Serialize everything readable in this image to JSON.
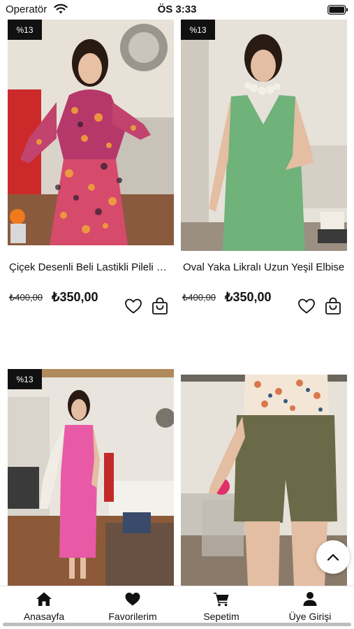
{
  "status_bar": {
    "carrier": "Operatör",
    "time": "ÖS 3:33"
  },
  "products": [
    {
      "badge": "%13",
      "title": "Çiçek Desenli Beli Lastikli Pileli Elbise",
      "old_price": "₺400,00",
      "price": "₺350,00"
    },
    {
      "badge": "%13",
      "title": "Oval Yaka Likralı Uzun Yeşil Elbise",
      "old_price": "₺400,00",
      "price": "₺350,00"
    },
    {
      "badge": "%13"
    },
    {
      "badge": ""
    }
  ],
  "tab_bar": {
    "home": "Anasayfa",
    "favorites": "Favorilerim",
    "cart": "Sepetim",
    "account": "Üye Girişi"
  },
  "icons": {
    "wifi": "wifi-icon",
    "battery": "battery-icon",
    "favorite": "heart-outline-icon",
    "add_to_cart": "shopping-bag-icon",
    "scroll_top": "chevron-up-icon",
    "home": "home-icon",
    "favorites": "heart-filled-icon",
    "cart": "cart-icon",
    "account": "user-icon"
  }
}
